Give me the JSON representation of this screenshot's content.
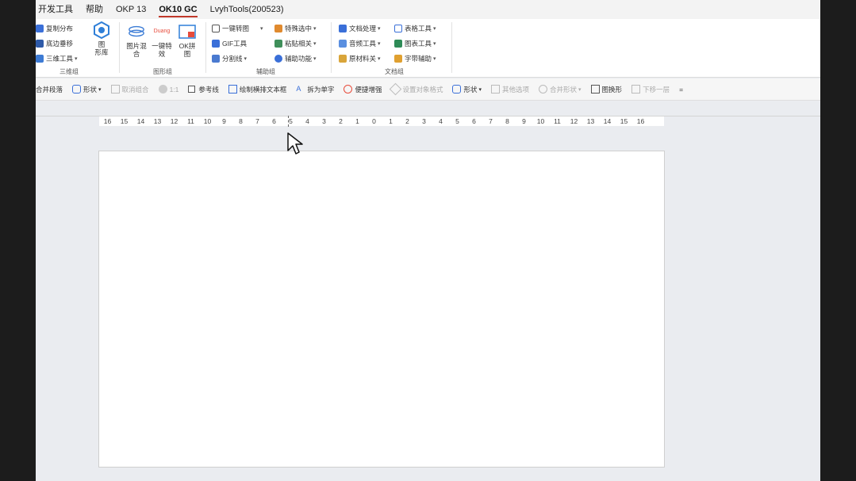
{
  "tabs": [
    {
      "label": "开发工具",
      "active": false
    },
    {
      "label": "帮助",
      "active": false
    },
    {
      "label": "OKP 13",
      "active": false
    },
    {
      "label": "OK10 GC",
      "active": true
    },
    {
      "label": "LvyhTools(200523)",
      "active": false
    }
  ],
  "ribbon": {
    "group_3d": {
      "label": "三维组",
      "items": [
        "复制分布",
        "底边垂移",
        "三维工具"
      ],
      "big_label_1": "图",
      "big_label_2": "形库"
    },
    "group_shape": {
      "label": "图形组",
      "big1_line1": "图片混",
      "big1_line2": "合",
      "big2_line1": "一键特",
      "big2_line2": "效",
      "big3_line1": "OK拼",
      "big3_line2": "图",
      "icon_text": "Duang"
    },
    "group_assist": {
      "label": "辅助组",
      "col1": [
        "一键转图",
        "GIF工具",
        "分割线"
      ],
      "col2": [
        "特殊选中",
        "粘贴相关",
        "辅助功能"
      ]
    },
    "group_text": {
      "label": "文档组",
      "col1": [
        "文档处理",
        "音频工具",
        "原材料关"
      ],
      "col2": [
        "表格工具",
        "图表工具",
        "字带辅助"
      ]
    }
  },
  "quickbar": {
    "items": [
      {
        "label": "合并段落",
        "disabled": false
      },
      {
        "label": "形状",
        "disabled": false,
        "dropdown": true
      },
      {
        "label": "取消组合",
        "disabled": true
      },
      {
        "label": "1:1",
        "disabled": true
      },
      {
        "label": "参考线",
        "disabled": false,
        "checkbox": true
      },
      {
        "label": "绘制横排文本框",
        "disabled": false
      },
      {
        "label": "拆为单字",
        "disabled": false
      },
      {
        "label": "便捷增强",
        "disabled": false
      },
      {
        "label": "设置对象格式",
        "disabled": true
      },
      {
        "label": "形状",
        "disabled": false,
        "dropdown": true
      },
      {
        "label": "其他选项",
        "disabled": true
      },
      {
        "label": "合并形状",
        "disabled": true,
        "dropdown": true
      },
      {
        "label": "图换形",
        "disabled": false
      },
      {
        "label": "下移一层",
        "disabled": true
      }
    ],
    "overflow": "="
  },
  "ruler": {
    "ticks": [
      "16",
      "15",
      "14",
      "13",
      "12",
      "11",
      "10",
      "9",
      "8",
      "7",
      "6",
      "5",
      "4",
      "3",
      "2",
      "1",
      "0",
      "1",
      "2",
      "3",
      "4",
      "5",
      "6",
      "7",
      "8",
      "9",
      "10",
      "11",
      "12",
      "13",
      "14",
      "15",
      "16"
    ]
  },
  "colors": {
    "accent_tab": "#c0392b",
    "ribbon_bg": "#ffffff",
    "canvas_bg": "#eaecf0"
  }
}
